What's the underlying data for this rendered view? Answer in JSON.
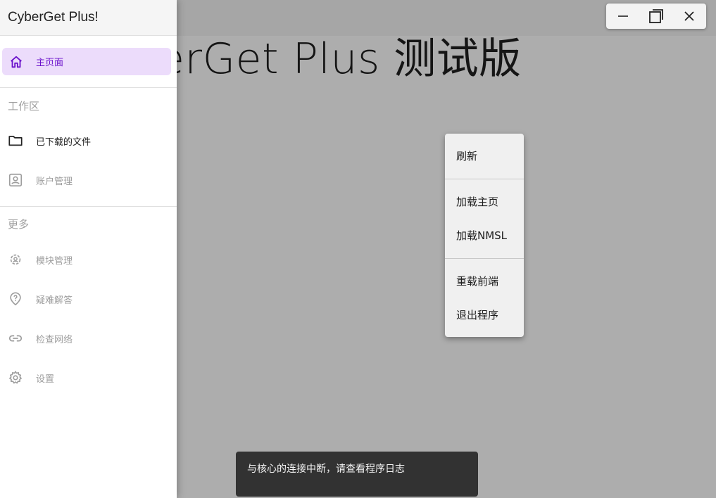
{
  "app": {
    "title": "CyberGet Plus!",
    "hero_title": "CyberGet Plus 测试版"
  },
  "window_controls": {
    "minimize_icon": "minimize-icon",
    "maximize_icon": "maximize-icon",
    "close_icon": "close-icon"
  },
  "drawer": {
    "header": "CyberGet Plus!",
    "home": {
      "label": "主页面",
      "icon": "home-icon",
      "active": true
    },
    "workspace_section": "工作区",
    "workspace_items": [
      {
        "label": "已下载的文件",
        "icon": "folder-icon",
        "enabled": true
      },
      {
        "label": "账户管理",
        "icon": "account-box-icon",
        "enabled": false
      }
    ],
    "more_section": "更多",
    "more_items": [
      {
        "label": "模块管理",
        "icon": "module-gear-icon",
        "enabled": false
      },
      {
        "label": "疑难解答",
        "icon": "help-icon",
        "enabled": false
      },
      {
        "label": "检查网络",
        "icon": "link-icon",
        "enabled": false
      },
      {
        "label": "设置",
        "icon": "settings-icon",
        "enabled": false
      }
    ]
  },
  "context_menu": {
    "items": [
      "刷新",
      "加载主页",
      "加载NMSL",
      "重载前端",
      "退出程序"
    ]
  },
  "snackbar": {
    "message": "与核心的连接中断，请查看程序日志"
  },
  "colors": {
    "accent": "#6a11cb",
    "active_bg": "#ecdcfb",
    "snackbar_bg": "#323232",
    "disabled_text": "#9e9e9e"
  }
}
